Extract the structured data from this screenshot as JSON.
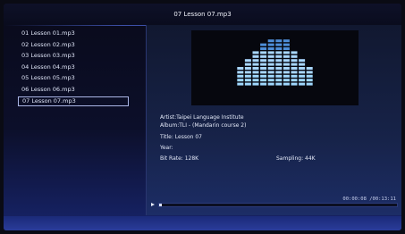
{
  "title": "07 Lesson 07.mp3",
  "playlist": [
    {
      "label": "01 Lesson 01.mp3"
    },
    {
      "label": "02 Lesson 02.mp3"
    },
    {
      "label": "03 Lesson 03.mp3"
    },
    {
      "label": "04 Lesson 04.mp3"
    },
    {
      "label": "05 Lesson 05.mp3"
    },
    {
      "label": "06 Lesson 06.mp3"
    },
    {
      "label": "07 Lesson 07.mp3"
    }
  ],
  "selected_index": 6,
  "info": {
    "artist": "Artist:Taipei Language Institute",
    "album": "Album:TLI -  (Mandarin course 2)",
    "title": "Title:  Lesson 07",
    "year": "Year:",
    "bitrate": "Bit Rate: 128K",
    "sampling": "Sampling: 44K"
  },
  "time": "00:00:08 /00:13:11",
  "progress_fraction": 0.01,
  "visualizer_levels": [
    5,
    7,
    9,
    11,
    12,
    12,
    12,
    9,
    7,
    5
  ],
  "colors": {
    "accent": "#a8d6ff",
    "bar_bright": "#9fd8ff",
    "bar_dim": "#4e8ed8"
  }
}
